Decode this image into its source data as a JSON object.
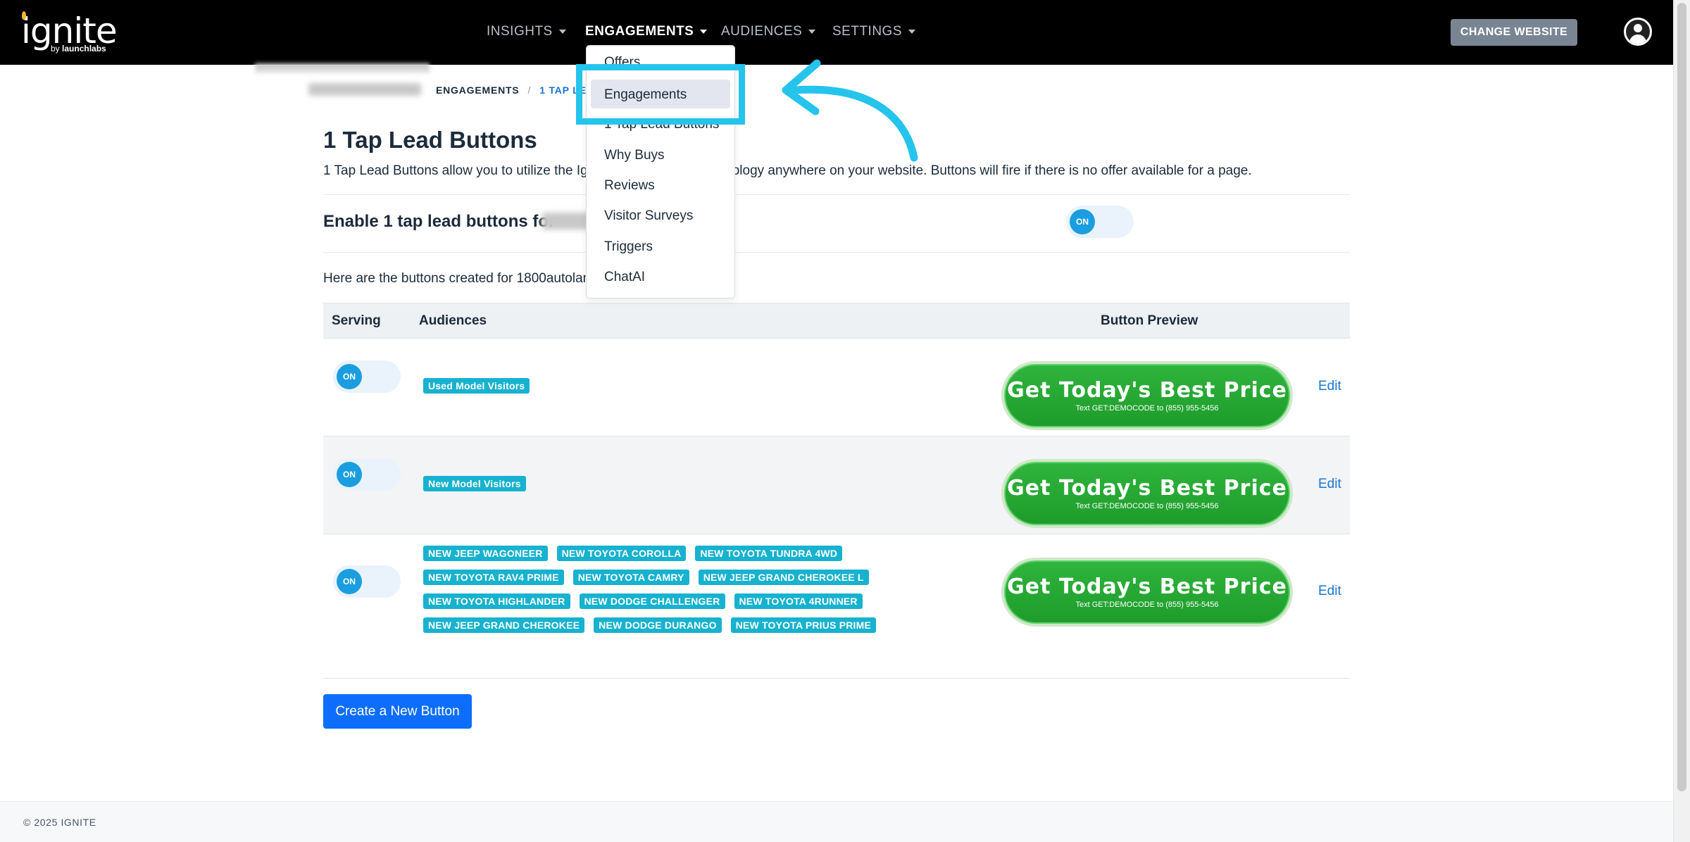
{
  "header": {
    "logo_word": "ignite",
    "logo_by": "by",
    "logo_brand": "launchlabs",
    "nav": [
      "INSIGHTS",
      "ENGAGEMENTS",
      "AUDIENCES",
      "SETTINGS"
    ],
    "change_website": "CHANGE WEBSITE"
  },
  "breadcrumb": {
    "section": "ENGAGEMENTS",
    "separator": "/",
    "current": "1 TAP LEA"
  },
  "page": {
    "title": "1 Tap Lead Buttons",
    "desc_before": "1 Tap Lead Buttons allow you to utilize the Ign",
    "desc_after": "technology anywhere on your website. Buttons will fire if there is no offer available for a page.",
    "enable_label": "Enable 1 tap lead buttons for",
    "here_text": "Here are the buttons created for 1800autolan",
    "toggle_label": "ON"
  },
  "table": {
    "headers": {
      "serving": "Serving",
      "audiences": "Audiences",
      "preview": "Button Preview"
    },
    "rows": [
      {
        "toggle": "ON",
        "tags": [
          "Used Model Visitors"
        ],
        "cta_big": "Get Today's Best Price",
        "cta_small": "Text GET:DEMOCODE to (855) 955-5456",
        "edit": "Edit"
      },
      {
        "toggle": "ON",
        "tags": [
          "New Model Visitors"
        ],
        "cta_big": "Get Today's Best Price",
        "cta_small": "Text GET:DEMOCODE to (855) 955-5456",
        "edit": "Edit"
      },
      {
        "toggle": "ON",
        "tags": [
          "NEW JEEP WAGONEER",
          "NEW TOYOTA COROLLA",
          "NEW TOYOTA TUNDRA 4WD",
          "NEW TOYOTA RAV4 PRIME",
          "NEW TOYOTA CAMRY",
          "NEW JEEP GRAND CHEROKEE L",
          "NEW TOYOTA HIGHLANDER",
          "NEW DODGE CHALLENGER",
          "NEW TOYOTA 4RUNNER",
          "NEW JEEP GRAND CHEROKEE",
          "NEW DODGE DURANGO",
          "NEW TOYOTA PRIUS PRIME"
        ],
        "cta_big": "Get Today's Best Price",
        "cta_small": "Text GET:DEMOCODE to (855) 955-5456",
        "edit": "Edit"
      }
    ]
  },
  "create_button": "Create a New Button",
  "footer": "© 2025 IGNITE",
  "dropdown": {
    "items": [
      "Offers",
      "Engagements",
      "1 Tap Lead Buttons",
      "Why Buys",
      "Reviews",
      "Visitor Surveys",
      "Triggers",
      "ChatAI"
    ],
    "highlighted": "Engagements"
  },
  "colors": {
    "nav_bg": "#000000",
    "accent_blue": "#1976d2",
    "primary_button": "#0d6efd",
    "tag_teal": "#17b2cf",
    "cta_green": "#22a630",
    "annotation_cyan": "#25c4ec"
  }
}
